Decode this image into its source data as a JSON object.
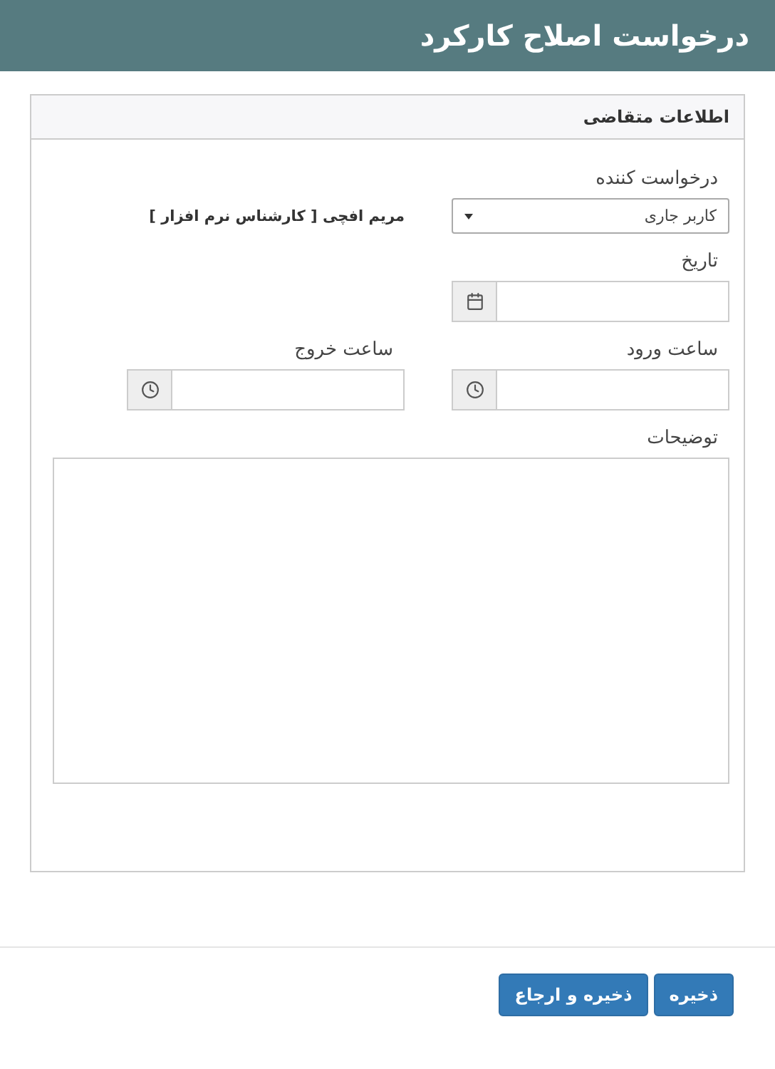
{
  "window": {
    "title": "درخواست اصلاح کارکرد"
  },
  "panel": {
    "title": "اطلاعات متقاضی"
  },
  "requester": {
    "label": "درخواست کننده",
    "value": "کاربر جاری",
    "person": "مریم افچی [ کارشناس نرم افزار ]"
  },
  "date": {
    "label": "تاریخ"
  },
  "times": [
    {
      "label": "ساعت ورود"
    },
    {
      "label": "ساعت خروج"
    }
  ],
  "description": {
    "label": "توضیحات"
  },
  "buttons": [
    {
      "label": "ذخیره"
    },
    {
      "label": "ذخیره و ارجاع"
    }
  ]
}
